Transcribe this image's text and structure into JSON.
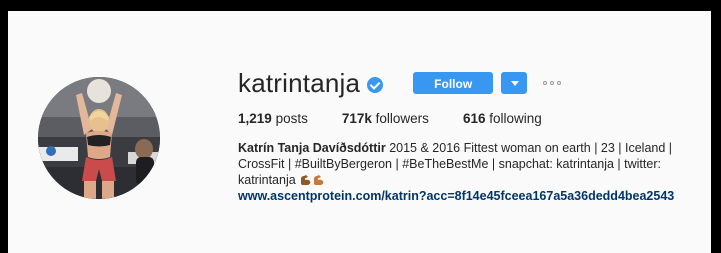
{
  "profile": {
    "username": "katrintanja",
    "verified": true,
    "follow_label": "Follow",
    "stats": {
      "posts_count": "1,219",
      "posts_label": "posts",
      "followers_count": "717k",
      "followers_label": "followers",
      "following_count": "616",
      "following_label": "following"
    },
    "full_name": "Katrín Tanja Davíðsdóttir",
    "bio_line": "2015 & 2016 Fittest woman on earth | 23 | Iceland | CrossFit |",
    "hashtag_1": "#BuiltByBergeron",
    "separator": "|",
    "hashtag_2": "#BeTheBestMe",
    "bio_tail": "| snapchat: katrintanja | twitter: katrintanja",
    "website": "www.ascentprotein.com/katrin?acc=8f14e45fceea167a5a36dedd4bea2543",
    "emojis": [
      "flexed-biceps-emoji",
      "flexed-biceps-emoji"
    ]
  },
  "colors": {
    "accent": "#3897f0",
    "text": "#262626",
    "link": "#003569",
    "background": "#fafafa",
    "frame": "#000000"
  }
}
